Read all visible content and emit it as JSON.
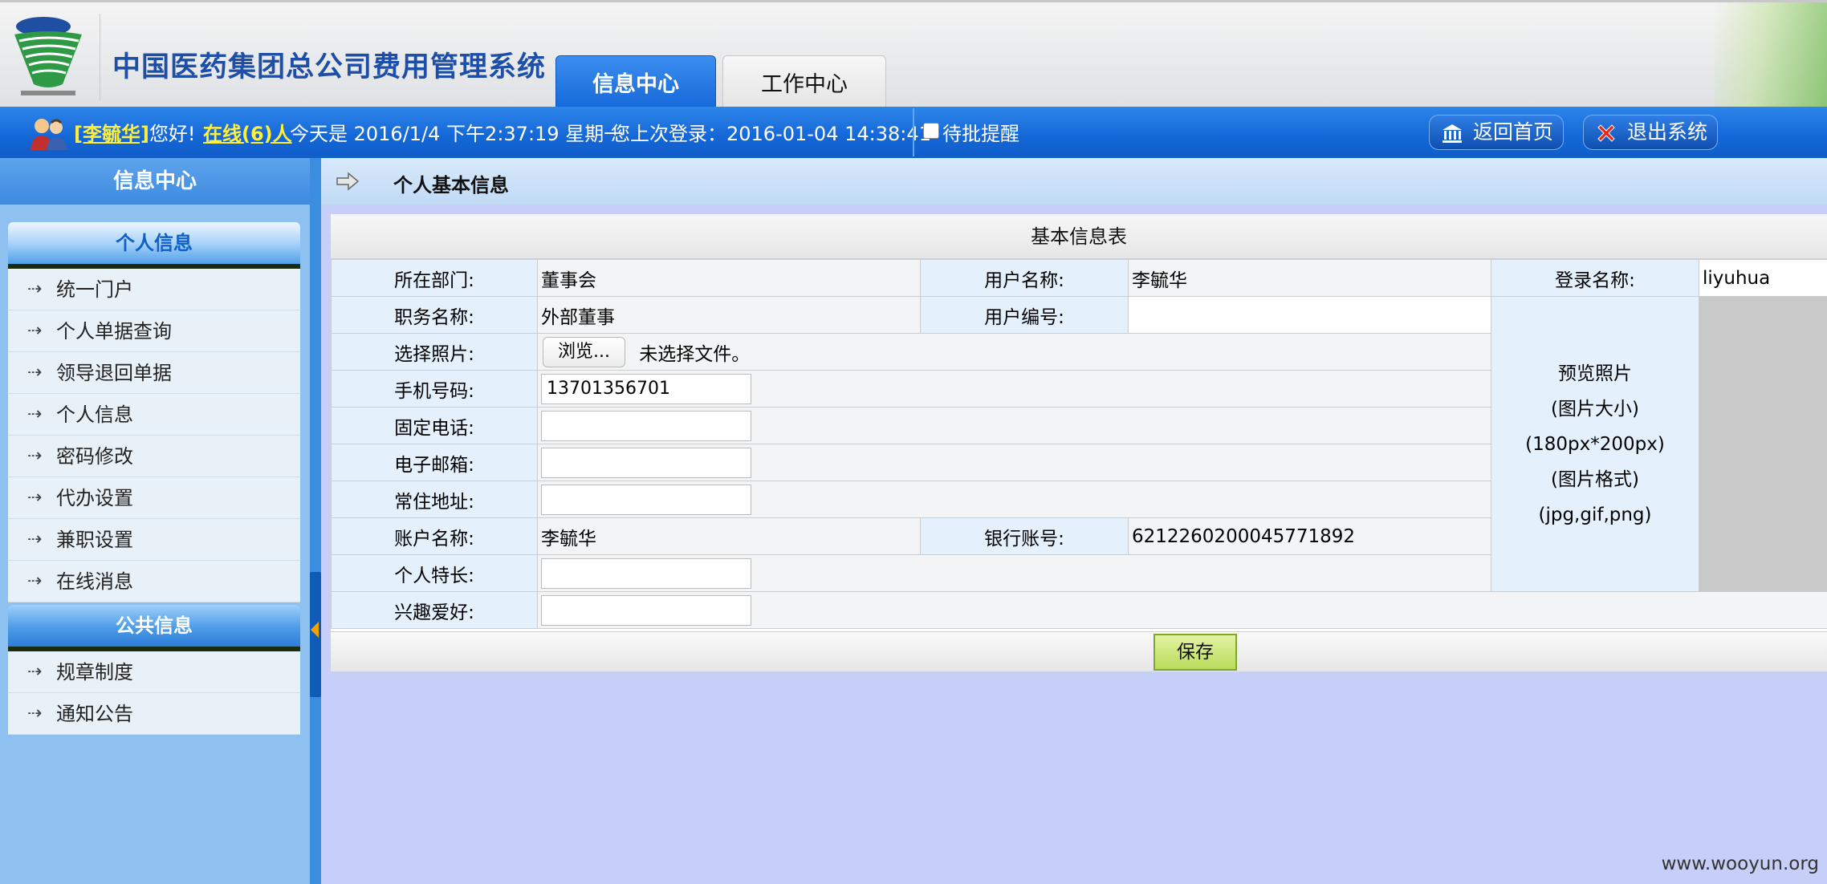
{
  "header": {
    "system_title": "中国医药集团总公司费用管理系统",
    "tabs": [
      {
        "label": "信息中心",
        "active": true
      },
      {
        "label": "工作中心",
        "active": false
      }
    ]
  },
  "statusbar": {
    "user_link": "[李毓华]",
    "greeting": "您好!",
    "online_link": "在线(6)人",
    "today_text": "今天是 2016/1/4 下午2:37:19 星期一",
    "last_login_text": "您上次登录：2016-01-04 14:38:41",
    "pending_label": "待批提醒",
    "home_button": "返回首页",
    "exit_button": "退出系统"
  },
  "sidebar": {
    "title": "信息中心",
    "groups": [
      {
        "label": "个人信息",
        "items": [
          "统一门户",
          "个人单据查询",
          "领导退回单据",
          "个人信息",
          "密码修改",
          "代办设置",
          "兼职设置",
          "在线消息"
        ]
      },
      {
        "label": "公共信息",
        "items": [
          "规章制度",
          "通知公告"
        ]
      }
    ]
  },
  "content": {
    "breadcrumb_title": "个人基本信息",
    "form_title": "基本信息表",
    "fields": {
      "department_label": "所在部门:",
      "department_value": "董事会",
      "username_label": "用户名称:",
      "username_value": "李毓华",
      "login_label": "登录名称:",
      "login_value": "liyuhua",
      "position_label": "职务名称:",
      "position_value": "外部董事",
      "usercode_label": "用户编号:",
      "usercode_value": "",
      "photo_label": "选择照片:",
      "browse_button": "浏览...",
      "no_file_text": "未选择文件。",
      "mobile_label": "手机号码:",
      "mobile_value": "13701356701",
      "phone_label": "固定电话:",
      "phone_value": "",
      "email_label": "电子邮箱:",
      "email_value": "",
      "address_label": "常住地址:",
      "address_value": "",
      "account_name_label": "账户名称:",
      "account_name_value": "李毓华",
      "bank_account_label": "银行账号:",
      "bank_account_value": "6212260200045771892",
      "specialty_label": "个人特长:",
      "specialty_value": "",
      "hobby_label": "兴趣爱好:",
      "hobby_value": ""
    },
    "preview": [
      "预览照片",
      "(图片大小)",
      "(180px*200px)",
      "(图片格式)",
      "(jpg,gif,png)"
    ],
    "save_button": "保存"
  },
  "watermark": "www.wooyun.org",
  "colors": {
    "brand_blue": "#1466d6",
    "link_yellow": "#ffef3a",
    "content_bg": "#c6cff7",
    "sidebar_bg": "#8ec0f0"
  }
}
